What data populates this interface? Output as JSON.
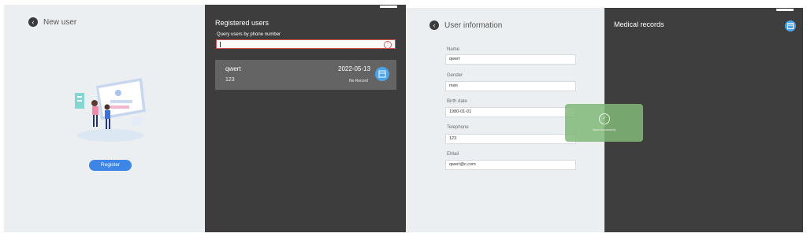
{
  "panel1": {
    "title": "New user",
    "register_label": "Register"
  },
  "panel2": {
    "title": "Registered users",
    "query_label": "Query users by phone number",
    "search_value": "",
    "user": {
      "name": "qwert",
      "phone": "123",
      "date": "2022-05-13",
      "record_status": "No Record"
    }
  },
  "panel3": {
    "title": "User information",
    "fields": [
      {
        "label": "Name",
        "value": "qwert"
      },
      {
        "label": "Gender",
        "value": "man"
      },
      {
        "label": "Birth date",
        "value": "1980-01-01"
      },
      {
        "label": "Telephone",
        "value": "123"
      },
      {
        "label": "EMail",
        "value": "qwert@c.com"
      }
    ]
  },
  "panel4": {
    "title": "Medical records",
    "toast": "Saved successfully"
  },
  "colors": {
    "accent": "#3d86e8",
    "dark_panel": "#3d3d3d",
    "light_panel": "#eceff2",
    "toast": "#81b978",
    "error": "#d9534f"
  }
}
